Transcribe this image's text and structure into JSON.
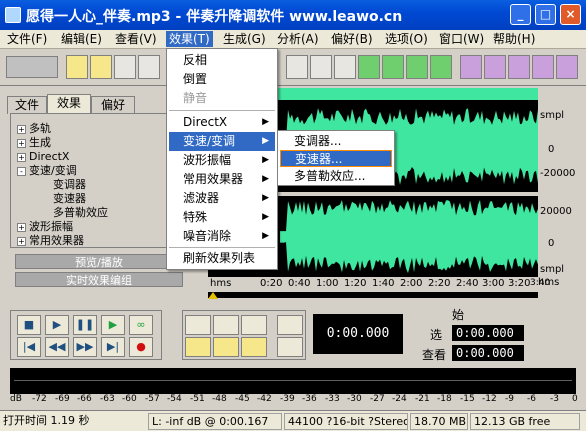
{
  "window": {
    "title": "愿得一人心_伴奏.mp3 - 伴奏升降调软件 www.leawo.cn",
    "min_label": "_",
    "max_label": "□",
    "close_label": "×"
  },
  "menubar": {
    "items": [
      "文件(F)",
      "编辑(E)",
      "查看(V)",
      "效果(T)",
      "生成(G)",
      "分析(A)",
      "偏好(B)",
      "选项(O)",
      "窗口(W)",
      "帮助(H)"
    ],
    "active_index": 3
  },
  "effects_menu": {
    "items": [
      {
        "label": "反相",
        "disabled": false
      },
      {
        "label": "倒置",
        "disabled": false
      },
      {
        "label": "静音",
        "disabled": true
      },
      {
        "label": "DirectX",
        "submenu": true
      },
      {
        "label": "变速/变调",
        "submenu": true,
        "highlighted": true
      },
      {
        "label": "波形振幅",
        "submenu": true
      },
      {
        "label": "常用效果器",
        "submenu": true
      },
      {
        "label": "滤波器",
        "submenu": true
      },
      {
        "label": "特殊",
        "submenu": true
      },
      {
        "label": "噪音消除",
        "submenu": true
      },
      {
        "label": "刷新效果列表"
      }
    ]
  },
  "speed_submenu": {
    "items": [
      "变调器...",
      "变速器...",
      "多普勒效应..."
    ],
    "highlighted_index": 1
  },
  "left_panel": {
    "tabs": [
      "文件",
      "效果",
      "偏好"
    ],
    "selected_tab": 1,
    "tree": [
      "多轨",
      "生成",
      "DirectX",
      "变速/变调",
      "变调器",
      "变速器",
      "多普勒效应",
      "波形振幅",
      "常用效果器"
    ],
    "preview_button": "预览/播放",
    "realtime_button": "实时效果编组"
  },
  "waveform": {
    "wave_color": "#3fe6a0",
    "scale_top": [
      "smpl",
      "0",
      "-20000"
    ],
    "scale_bottom": [
      "20000",
      "0",
      "smpl"
    ],
    "ruler_unit": "hms",
    "ruler_labels": [
      "0:20",
      "0:40",
      "1:00",
      "1:20",
      "1:40",
      "2:00",
      "2:20",
      "2:40",
      "3:00",
      "3:20",
      "3:40"
    ],
    "ruler_end_unit": "hms"
  },
  "transport": {
    "main_time": "0:00.000",
    "start_label": "始",
    "selection_label": "选",
    "selection_value": "0:00.000",
    "view_label": "查看",
    "view_value": "0:00.000"
  },
  "meter": {
    "labels": [
      "dB",
      "-72",
      "-69",
      "-66",
      "-63",
      "-60",
      "-57",
      "-54",
      "-51",
      "-48",
      "-45",
      "-42",
      "-39",
      "-36",
      "-33",
      "-30",
      "-27",
      "-24",
      "-21",
      "-18",
      "-15",
      "-12",
      "-9",
      "-6",
      "-3",
      "0"
    ]
  },
  "status": {
    "open_time": "打开时间  1.19 秒",
    "level": "L: -inf dB @  0:00.167",
    "format": "44100 ?16-bit ?Stereo",
    "size": "18.70 MB",
    "free": "12.13 GB free"
  }
}
